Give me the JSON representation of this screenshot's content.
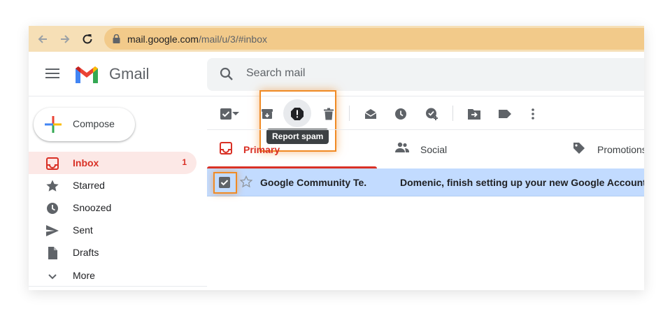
{
  "browser": {
    "url_host": "mail.google.com",
    "url_path": "/mail/u/3/#inbox"
  },
  "app": {
    "name": "Gmail"
  },
  "search": {
    "placeholder": "Search mail"
  },
  "compose": {
    "label": "Compose"
  },
  "sidebar": {
    "items": [
      {
        "label": "Inbox",
        "count": "1",
        "icon": "inbox-icon",
        "active": true
      },
      {
        "label": "Starred",
        "icon": "star-icon"
      },
      {
        "label": "Snoozed",
        "icon": "clock-icon"
      },
      {
        "label": "Sent",
        "icon": "send-icon"
      },
      {
        "label": "Drafts",
        "icon": "draft-icon"
      },
      {
        "label": "More",
        "icon": "chevron-down-icon"
      }
    ]
  },
  "toolbar": {
    "tooltip": "Report spam",
    "icons": [
      "select-checkbox-icon",
      "dropdown-icon",
      "archive-icon",
      "report-spam-icon",
      "delete-icon",
      "mark-as-read-icon",
      "snooze-icon",
      "add-to-tasks-icon",
      "move-to-icon",
      "label-icon",
      "more-options-icon"
    ]
  },
  "tabs": [
    {
      "label": "Primary",
      "icon": "inbox-icon",
      "active": true
    },
    {
      "label": "Social",
      "icon": "people-icon"
    },
    {
      "label": "Promotions",
      "icon": "tag-icon"
    }
  ],
  "emails": [
    {
      "sender": "Google Community Te.",
      "subject": "Domenic, finish setting up your new Google Account -",
      "selected": true
    }
  ],
  "colors": {
    "accent_red": "#d93025",
    "highlight_orange": "#f08a24",
    "selected_row": "#c2dbff",
    "browser_bar": "#f6dfb6"
  }
}
